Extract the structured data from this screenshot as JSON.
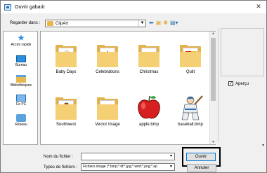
{
  "window": {
    "title": "Ouvrir gabarit",
    "close_glyph": "✕"
  },
  "lookin": {
    "label": "Regarder dans :",
    "value": "ClipArt"
  },
  "places": [
    {
      "label": "Accès rapide",
      "icon": "star-icon"
    },
    {
      "label": "Bureau",
      "icon": "desktop-icon"
    },
    {
      "label": "Bibliothèques",
      "icon": "libraries-icon"
    },
    {
      "label": "Ce PC",
      "icon": "computer-icon"
    },
    {
      "label": "Réseau",
      "icon": "network-icon"
    }
  ],
  "files": [
    {
      "name": "Baby Days",
      "kind": "folder"
    },
    {
      "name": "Celebrations",
      "kind": "folder"
    },
    {
      "name": "Christmas",
      "kind": "folder"
    },
    {
      "name": "Quilt",
      "kind": "folder"
    },
    {
      "name": "Southwest",
      "kind": "folder"
    },
    {
      "name": "Vector Image",
      "kind": "folder"
    },
    {
      "name": "apple.bmp",
      "kind": "image"
    },
    {
      "name": "baseball.bmp",
      "kind": "image"
    }
  ],
  "preview": {
    "label": "Aperçu",
    "checked": true
  },
  "filename": {
    "label": "Nom du fichier :",
    "value": ""
  },
  "filetype": {
    "label": "Types de fichiers :",
    "value": "Fichiers image (*.bmp;*.tif;*.jpg;*.wmf;*.png;*.ep"
  },
  "buttons": {
    "open": "Ouvrir",
    "cancel": "Annuler"
  },
  "colors": {
    "folder": "#e3b24a",
    "accent": "#0078d7",
    "apple_red": "#d81f1f"
  }
}
